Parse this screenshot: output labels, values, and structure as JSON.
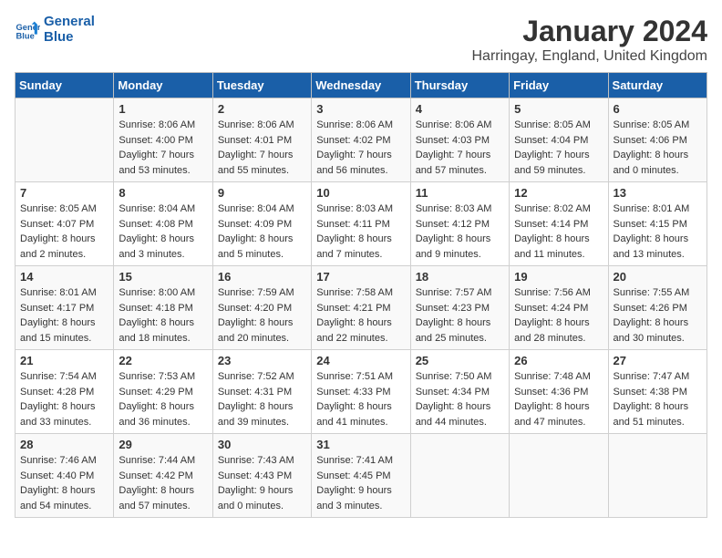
{
  "logo": {
    "line1": "General",
    "line2": "Blue"
  },
  "title": "January 2024",
  "location": "Harringay, England, United Kingdom",
  "days_of_week": [
    "Sunday",
    "Monday",
    "Tuesday",
    "Wednesday",
    "Thursday",
    "Friday",
    "Saturday"
  ],
  "weeks": [
    [
      {
        "day": "",
        "info": ""
      },
      {
        "day": "1",
        "info": "Sunrise: 8:06 AM\nSunset: 4:00 PM\nDaylight: 7 hours\nand 53 minutes."
      },
      {
        "day": "2",
        "info": "Sunrise: 8:06 AM\nSunset: 4:01 PM\nDaylight: 7 hours\nand 55 minutes."
      },
      {
        "day": "3",
        "info": "Sunrise: 8:06 AM\nSunset: 4:02 PM\nDaylight: 7 hours\nand 56 minutes."
      },
      {
        "day": "4",
        "info": "Sunrise: 8:06 AM\nSunset: 4:03 PM\nDaylight: 7 hours\nand 57 minutes."
      },
      {
        "day": "5",
        "info": "Sunrise: 8:05 AM\nSunset: 4:04 PM\nDaylight: 7 hours\nand 59 minutes."
      },
      {
        "day": "6",
        "info": "Sunrise: 8:05 AM\nSunset: 4:06 PM\nDaylight: 8 hours\nand 0 minutes."
      }
    ],
    [
      {
        "day": "7",
        "info": "Sunrise: 8:05 AM\nSunset: 4:07 PM\nDaylight: 8 hours\nand 2 minutes."
      },
      {
        "day": "8",
        "info": "Sunrise: 8:04 AM\nSunset: 4:08 PM\nDaylight: 8 hours\nand 3 minutes."
      },
      {
        "day": "9",
        "info": "Sunrise: 8:04 AM\nSunset: 4:09 PM\nDaylight: 8 hours\nand 5 minutes."
      },
      {
        "day": "10",
        "info": "Sunrise: 8:03 AM\nSunset: 4:11 PM\nDaylight: 8 hours\nand 7 minutes."
      },
      {
        "day": "11",
        "info": "Sunrise: 8:03 AM\nSunset: 4:12 PM\nDaylight: 8 hours\nand 9 minutes."
      },
      {
        "day": "12",
        "info": "Sunrise: 8:02 AM\nSunset: 4:14 PM\nDaylight: 8 hours\nand 11 minutes."
      },
      {
        "day": "13",
        "info": "Sunrise: 8:01 AM\nSunset: 4:15 PM\nDaylight: 8 hours\nand 13 minutes."
      }
    ],
    [
      {
        "day": "14",
        "info": "Sunrise: 8:01 AM\nSunset: 4:17 PM\nDaylight: 8 hours\nand 15 minutes."
      },
      {
        "day": "15",
        "info": "Sunrise: 8:00 AM\nSunset: 4:18 PM\nDaylight: 8 hours\nand 18 minutes."
      },
      {
        "day": "16",
        "info": "Sunrise: 7:59 AM\nSunset: 4:20 PM\nDaylight: 8 hours\nand 20 minutes."
      },
      {
        "day": "17",
        "info": "Sunrise: 7:58 AM\nSunset: 4:21 PM\nDaylight: 8 hours\nand 22 minutes."
      },
      {
        "day": "18",
        "info": "Sunrise: 7:57 AM\nSunset: 4:23 PM\nDaylight: 8 hours\nand 25 minutes."
      },
      {
        "day": "19",
        "info": "Sunrise: 7:56 AM\nSunset: 4:24 PM\nDaylight: 8 hours\nand 28 minutes."
      },
      {
        "day": "20",
        "info": "Sunrise: 7:55 AM\nSunset: 4:26 PM\nDaylight: 8 hours\nand 30 minutes."
      }
    ],
    [
      {
        "day": "21",
        "info": "Sunrise: 7:54 AM\nSunset: 4:28 PM\nDaylight: 8 hours\nand 33 minutes."
      },
      {
        "day": "22",
        "info": "Sunrise: 7:53 AM\nSunset: 4:29 PM\nDaylight: 8 hours\nand 36 minutes."
      },
      {
        "day": "23",
        "info": "Sunrise: 7:52 AM\nSunset: 4:31 PM\nDaylight: 8 hours\nand 39 minutes."
      },
      {
        "day": "24",
        "info": "Sunrise: 7:51 AM\nSunset: 4:33 PM\nDaylight: 8 hours\nand 41 minutes."
      },
      {
        "day": "25",
        "info": "Sunrise: 7:50 AM\nSunset: 4:34 PM\nDaylight: 8 hours\nand 44 minutes."
      },
      {
        "day": "26",
        "info": "Sunrise: 7:48 AM\nSunset: 4:36 PM\nDaylight: 8 hours\nand 47 minutes."
      },
      {
        "day": "27",
        "info": "Sunrise: 7:47 AM\nSunset: 4:38 PM\nDaylight: 8 hours\nand 51 minutes."
      }
    ],
    [
      {
        "day": "28",
        "info": "Sunrise: 7:46 AM\nSunset: 4:40 PM\nDaylight: 8 hours\nand 54 minutes."
      },
      {
        "day": "29",
        "info": "Sunrise: 7:44 AM\nSunset: 4:42 PM\nDaylight: 8 hours\nand 57 minutes."
      },
      {
        "day": "30",
        "info": "Sunrise: 7:43 AM\nSunset: 4:43 PM\nDaylight: 9 hours\nand 0 minutes."
      },
      {
        "day": "31",
        "info": "Sunrise: 7:41 AM\nSunset: 4:45 PM\nDaylight: 9 hours\nand 3 minutes."
      },
      {
        "day": "",
        "info": ""
      },
      {
        "day": "",
        "info": ""
      },
      {
        "day": "",
        "info": ""
      }
    ]
  ]
}
